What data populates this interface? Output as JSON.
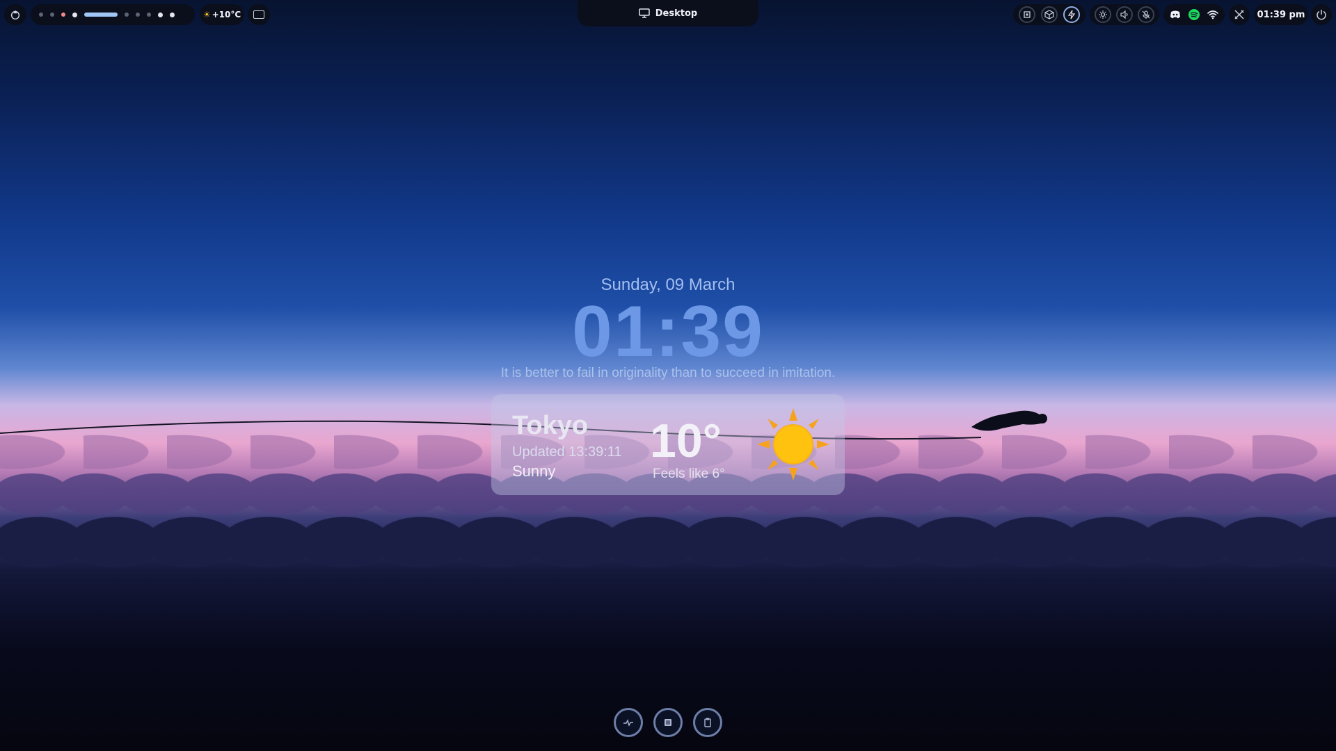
{
  "topbar": {
    "launcher_icon": "arch-logo-icon",
    "workspaces": [
      {
        "id": 1,
        "state": "empty"
      },
      {
        "id": 2,
        "state": "empty"
      },
      {
        "id": 3,
        "state": "urgent"
      },
      {
        "id": 4,
        "state": "occupied"
      },
      {
        "id": 5,
        "state": "active"
      },
      {
        "id": 6,
        "state": "empty"
      },
      {
        "id": 7,
        "state": "empty"
      },
      {
        "id": 8,
        "state": "empty"
      },
      {
        "id": 9,
        "state": "occupied"
      },
      {
        "id": 10,
        "state": "occupied"
      }
    ],
    "weather_label": "+10°C",
    "window_title": "Desktop",
    "clock": "01:39 pm",
    "system_icons": [
      "cpu-icon",
      "package-icon",
      "power-bolt-icon"
    ],
    "control_icons": [
      "brightness-icon",
      "volume-icon",
      "mic-muted-icon"
    ],
    "tray_icons": [
      "discord-icon",
      "spotify-icon",
      "wifi-icon"
    ],
    "colors": {
      "bar_bg": "#0b0f1c",
      "active_ws": "#9fc6f4",
      "urgent_ws": "#f08a8a"
    }
  },
  "center": {
    "date": "Sunday, 09 March",
    "time": "01:39",
    "quote": "It is better to fail in originality than to succeed in imitation."
  },
  "weather_card": {
    "city": "Tokyo",
    "updated": "Updated 13:39:11",
    "condition": "Sunny",
    "temperature": "10°",
    "feels_like": "Feels like 6°",
    "icon": "sun-icon"
  },
  "dock": {
    "buttons": [
      "activity-icon",
      "tasks-icon",
      "clipboard-icon"
    ]
  }
}
